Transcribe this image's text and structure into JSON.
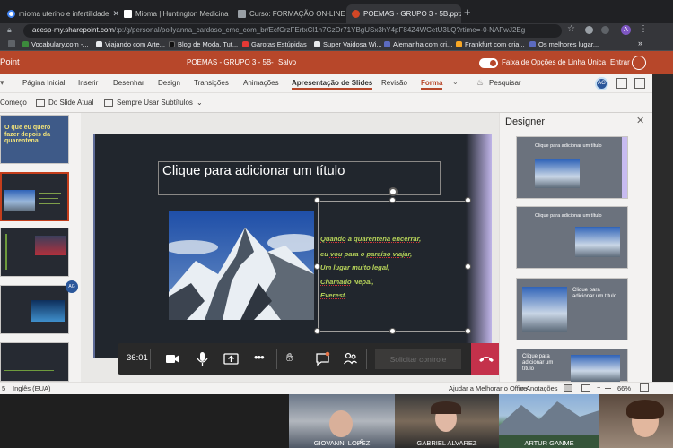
{
  "tabs": [
    {
      "label": "mioma uterino e infertilidade",
      "color": "#4285f4"
    },
    {
      "label": "Mioma | Huntington Medicina",
      "color": "#ffffff"
    },
    {
      "label": "Curso: FORMAÇÃO ON-LINE E",
      "color": "#9aa0a6"
    },
    {
      "label": "POEMAS - GRUPO 3 - 5B.pptx",
      "color": "#d24726"
    }
  ],
  "url": {
    "host": "acesp-my.sharepoint.com",
    "path": "/:p:/g/personal/pollyanna_cardoso_cmc_com_br/EcfCrzFErtxCl1h7GzDr71YBgUSx3hY4pF84Z4WCetU3LQ?rtime=-0-NAFwJ2Eg"
  },
  "bookmarks": [
    {
      "label": "Vocabulary.com -...",
      "color": "#3c8a3c"
    },
    {
      "label": "Viajando com Arte...",
      "color": "#e8eaed"
    },
    {
      "label": "Blog de Moda, Tut...",
      "color": "#111111"
    },
    {
      "label": "Garotas Estúpidas",
      "color": "#e53935"
    },
    {
      "label": "Super Vaidosa Wi...",
      "color": "#e8eaed"
    },
    {
      "label": "Alemanha com cri...",
      "color": "#5c6bc0"
    },
    {
      "label": "Frankfurt com cria...",
      "color": "#f9a825"
    },
    {
      "label": "Os melhores lugar...",
      "color": "#5c6bc0"
    }
  ],
  "office": {
    "app": "Point",
    "doc_title": "POEMAS - GRUPO 3 - 5B",
    "saved": "Salvo",
    "toggle_label": "Faixa de Opções de Linha Única",
    "signin": "Entrar",
    "avatar": "A"
  },
  "ribbon": {
    "menus": [
      "Página Inicial",
      "Inserir",
      "Desenhar",
      "Design",
      "Transições",
      "Animações",
      "Apresentação de Slides",
      "Revisão",
      "Forma"
    ],
    "selected": "Apresentação de Slides",
    "search": "Pesquisar",
    "tools": [
      "Começo",
      "Do Slide Atual",
      "Sempre Usar Subtítulos"
    ],
    "badge": "AG"
  },
  "thumbnails": {
    "first_text": "O que eu quero fazer depois da quarentena",
    "badge": "AG"
  },
  "slide": {
    "title_placeholder": "Clique para adicionar um título",
    "lines": [
      {
        "pre": "",
        "u": "Quando",
        "mid": " a ",
        "u2": "quarentena encerrar",
        "post": ","
      },
      {
        "pre": "eu ",
        "u": "vou",
        "mid": " para o ",
        "u2": "paraíso viajar",
        "post": ","
      },
      {
        "pre": "Um ",
        "u": "lugar",
        "mid": " ",
        "u2": "muito",
        "post": " legal,"
      },
      {
        "pre": "",
        "u": "Chamado",
        "mid": " Nepal,",
        "u2": "",
        "post": ""
      },
      {
        "pre": "",
        "u": "Everest",
        "mid": ".",
        "u2": "",
        "post": ""
      }
    ]
  },
  "meeting": {
    "timer": "36:01",
    "request_control": "Solicitar controle",
    "participants": [
      "GIOVANNI LOPEZ",
      "GABRIEL ALVAREZ",
      "ARTUR GANME",
      ""
    ]
  },
  "designer": {
    "title": "Designer",
    "ideas": [
      "Clique para adicionar um título",
      "Clique para adicionar um título",
      "Clique para adicionar um título",
      "Clique para adicionar um título"
    ]
  },
  "status": {
    "slide_num": "5",
    "language": "Inglês (EUA)",
    "help": "Ajudar a Melhorar o Office",
    "notes": "Anotações",
    "zoom": "66%"
  }
}
